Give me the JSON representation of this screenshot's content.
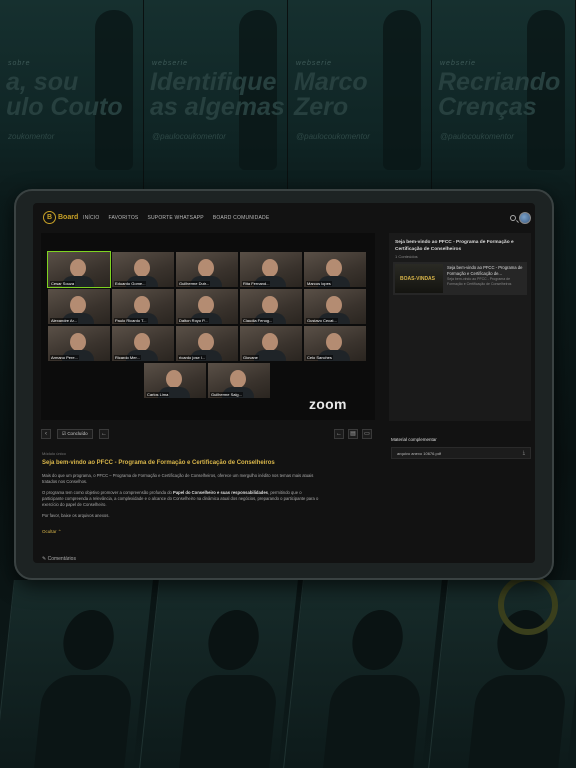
{
  "background": {
    "posters": [
      {
        "kicker": "sobre",
        "title_l1": "a, sou",
        "title_l2": "ulo Couto",
        "handle": "zoukomentor"
      },
      {
        "kicker": "webserie",
        "title_l1": "Identifique",
        "title_l2": "as algemas",
        "handle": "@paulocoukomentor"
      },
      {
        "kicker": "webserie",
        "title_l1": "Marco",
        "title_l2": "Zero",
        "handle": "@paulocoukomentor"
      },
      {
        "kicker": "webserie",
        "title_l1": "Recriando",
        "title_l2": "Crenças",
        "handle": "@paulocoukomentor"
      }
    ]
  },
  "app": {
    "logo_mark": "B",
    "logo_text": "Board",
    "nav": [
      "INÍCIO",
      "FAVORITOS",
      "SUPORTE WHATSAPP",
      "BOARD COMUNIDADE"
    ]
  },
  "video": {
    "brand": "zoom",
    "participants": [
      "Cesar Souza",
      "Eduardo Gome...",
      "Guilherme Dutr...",
      "Rita Fernand...",
      "Marcos lopes",
      "Alexandre Ar...",
      "Paulo Ricardo T...",
      "Dalton Royo P...",
      "Claudia Fenog...",
      "Gustavo Cecat...",
      "Armano Pere...",
      "Ricardo Mer...",
      "ricardo jose l...",
      "Giovane",
      "Celo Sanches",
      "Carlos Lima",
      "Guilherme Salg..."
    ]
  },
  "controls": {
    "done_label": "Concluído",
    "done_icon": "check-icon"
  },
  "lesson": {
    "meta": "Módulo único",
    "title": "Seja bem-vindo ao PFCC - Programa de Formação e Certificação de Conselheiros",
    "p1": "Mais do que um programa, o PFCC – Programa de Formação e Certificação de Conselheiros, oferece um mergulho inédito nos temas mais atuais tratados nos Conselhos.",
    "p2_a": "O programa tem como objetivo promover a compreensão profunda do ",
    "p2_bold": "Papel do Conselheiro e suas responsabilidades",
    "p2_b": ", permitindo que o participante compreenda a relevância, a complexidade e o alcance do Conselheiro na dinâmica atual dos negócios, preparando o participante para o exercício do papel de Conselheiro.",
    "p3": "Por favor, baixe os arquivos anexos.",
    "read_more": "Ocultar",
    "comments": "Comentários"
  },
  "sidebar": {
    "title": "Seja bem-vindo ao PFCC - Programa de Formação e Certificação de Conselheiros",
    "count": "1 Conteúdos",
    "item": {
      "thumb_text": "BOAS-VINDAS",
      "title": "Seja bem-vindo ao PFCC - Programa de Formação e Certificação de...",
      "subtitle": "Seja bem-vindo ao PFCC - Programa de Formação e Certificação de Conselheiros"
    }
  },
  "materials": {
    "title": "Material complementar",
    "file": "arquivo anexo 10676.pdf"
  }
}
